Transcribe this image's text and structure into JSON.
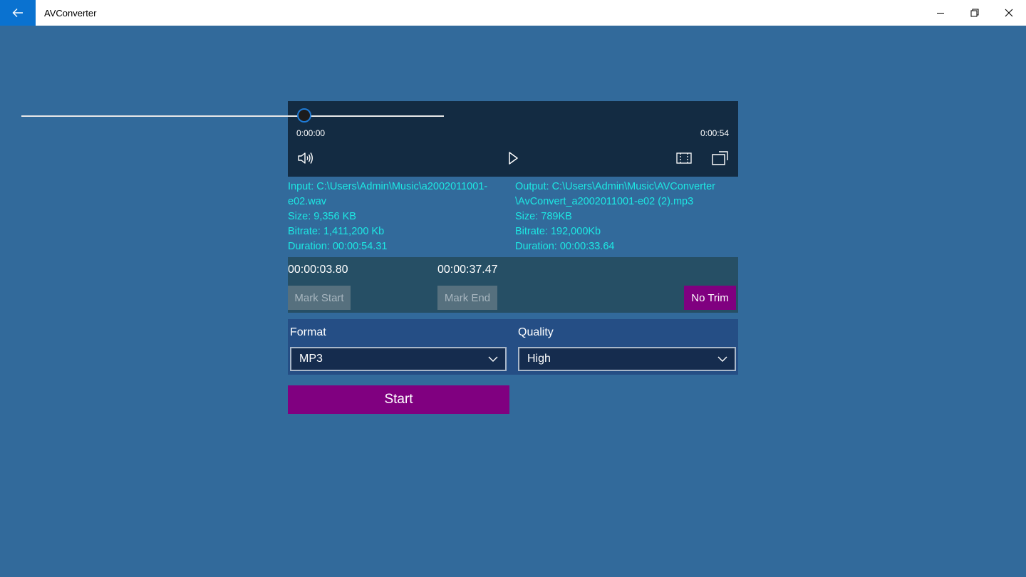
{
  "window": {
    "title": "AVConverter",
    "accent_color": "#0a72d0"
  },
  "player": {
    "current_time": "0:00:00",
    "total_time": "0:00:54",
    "progress": 0.0,
    "icons": [
      "volume-icon",
      "play-icon",
      "aspect-ratio-icon",
      "cast-icon"
    ]
  },
  "input": {
    "path_line1": "Input: C:\\Users\\Admin\\Music\\a2002011001-",
    "path_line2": "e02.wav",
    "size": "Size: 9,356 KB",
    "bitrate": "Bitrate: 1,411,200 Kb",
    "duration": "Duration: 00:00:54.31"
  },
  "output": {
    "path_line1": "Output: C:\\Users\\Admin\\Music\\AVConverter",
    "path_line2": "\\AvConvert_a2002011001-e02 (2).mp3",
    "size": "Size: 789KB",
    "bitrate": "Bitrate: 192,000Kb",
    "duration": "Duration: 00:00:33.64"
  },
  "trim": {
    "start_time": "00:00:03.80",
    "end_time": "00:00:37.47",
    "mark_start_label": "Mark Start",
    "mark_end_label": "Mark End",
    "no_trim_label": "No Trim"
  },
  "format": {
    "label": "Format",
    "selected": "MP3"
  },
  "quality": {
    "label": "Quality",
    "selected": "High"
  },
  "start_label": "Start",
  "colors": {
    "background": "#326a9b",
    "info_text": "#1de8e3",
    "purple": "#800080"
  }
}
